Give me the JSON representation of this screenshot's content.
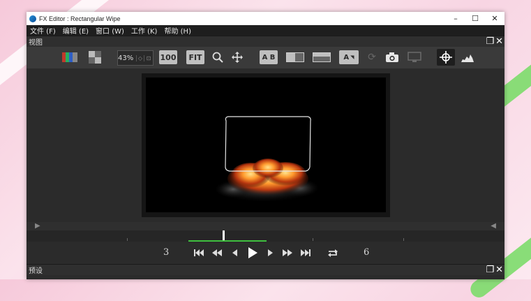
{
  "window": {
    "title": "FX Editor : Rectangular Wipe",
    "minimize_glyph": "–",
    "maximize_glyph": "☐",
    "close_glyph": "✕"
  },
  "menu": [
    {
      "label": "文件 (F)"
    },
    {
      "label": "编辑 (E)"
    },
    {
      "label": "窗口 (W)"
    },
    {
      "label": "工作 (K)"
    },
    {
      "label": "帮助 (H)"
    }
  ],
  "view_panel": {
    "title": "视图",
    "restore_glyph": "❐",
    "close_glyph": "✕"
  },
  "toolbar": {
    "zoom_value": "43%",
    "btn_100": "100",
    "btn_fit": "FIT",
    "btn_ab": "A B",
    "btn_a": "A"
  },
  "timeline": {
    "current_frame": "3",
    "end_frame": "6",
    "playhead_fraction": 0.41
  },
  "preset_panel": {
    "title": "预设",
    "restore_glyph": "❐",
    "close_glyph": "✕"
  },
  "colors": {
    "accent_green": "#3fbf3f",
    "panel_bg": "#2b2b2b",
    "toolbar_bg": "#3a3a3a"
  }
}
